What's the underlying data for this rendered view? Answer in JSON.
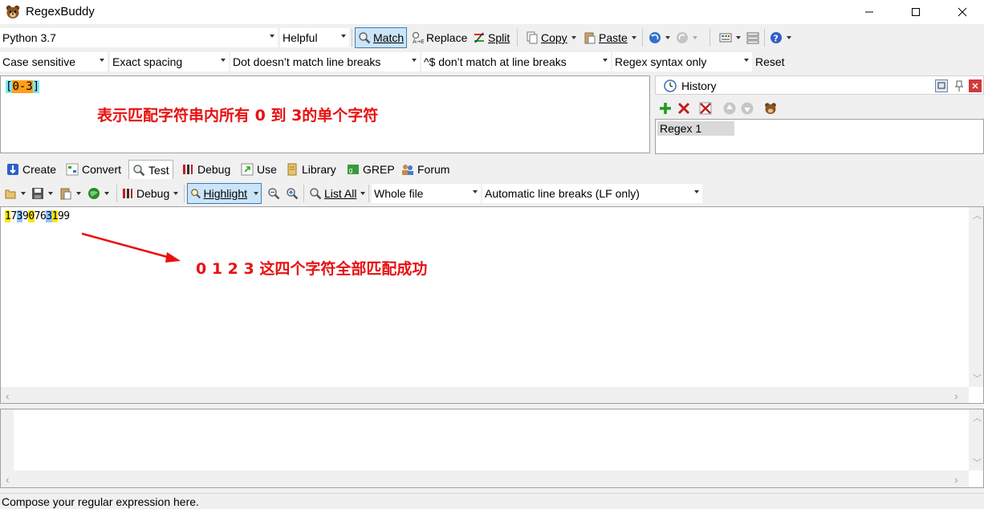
{
  "window": {
    "title": "RegexBuddy"
  },
  "toolbar1": {
    "flavor": "Python 3.7",
    "helper": "Helpful",
    "match": "Match",
    "replace": "Replace",
    "split": "Split",
    "copy": "Copy",
    "paste": "Paste"
  },
  "toolbar2": {
    "case": "Case sensitive",
    "spacing": "Exact spacing",
    "dot": "Dot doesn’t match line breaks",
    "anchors": "^$ don’t match at line breaks",
    "syntax": "Regex syntax only",
    "reset": "Reset"
  },
  "regex": {
    "open": "[",
    "body": "0-3",
    "close": "]",
    "annotation": "表示匹配字符串内所有 0 到 3的单个字符"
  },
  "history": {
    "title": "History",
    "items": [
      "Regex 1"
    ]
  },
  "tabs": [
    "Create",
    "Convert",
    "Test",
    "Debug",
    "Use",
    "Library",
    "GREP",
    "Forum"
  ],
  "test_toolbar": {
    "debug": "Debug",
    "highlight": "Highlight",
    "list_all": "List All",
    "scope": "Whole file",
    "line_breaks": "Automatic line breaks (LF only)"
  },
  "test_subject": {
    "segments": [
      {
        "text": "1",
        "hl": "yellow"
      },
      {
        "text": "7",
        "hl": "none"
      },
      {
        "text": "3",
        "hl": "blue"
      },
      {
        "text": "9",
        "hl": "none"
      },
      {
        "text": "0",
        "hl": "yellow"
      },
      {
        "text": "76",
        "hl": "none"
      },
      {
        "text": "3",
        "hl": "blue"
      },
      {
        "text": "1",
        "hl": "yellow"
      },
      {
        "text": "99",
        "hl": "none"
      }
    ],
    "annotation": "0 1 2 3 这四个字符全部匹配成功"
  },
  "status": {
    "text": "Compose your regular expression here."
  },
  "colors": {
    "annotation": "#e81010",
    "highlight_yellow": "#ffe600",
    "highlight_blue": "#8ec5ff",
    "regex_bracket": "#7fe8f0",
    "regex_range": "#ff9e1a"
  }
}
